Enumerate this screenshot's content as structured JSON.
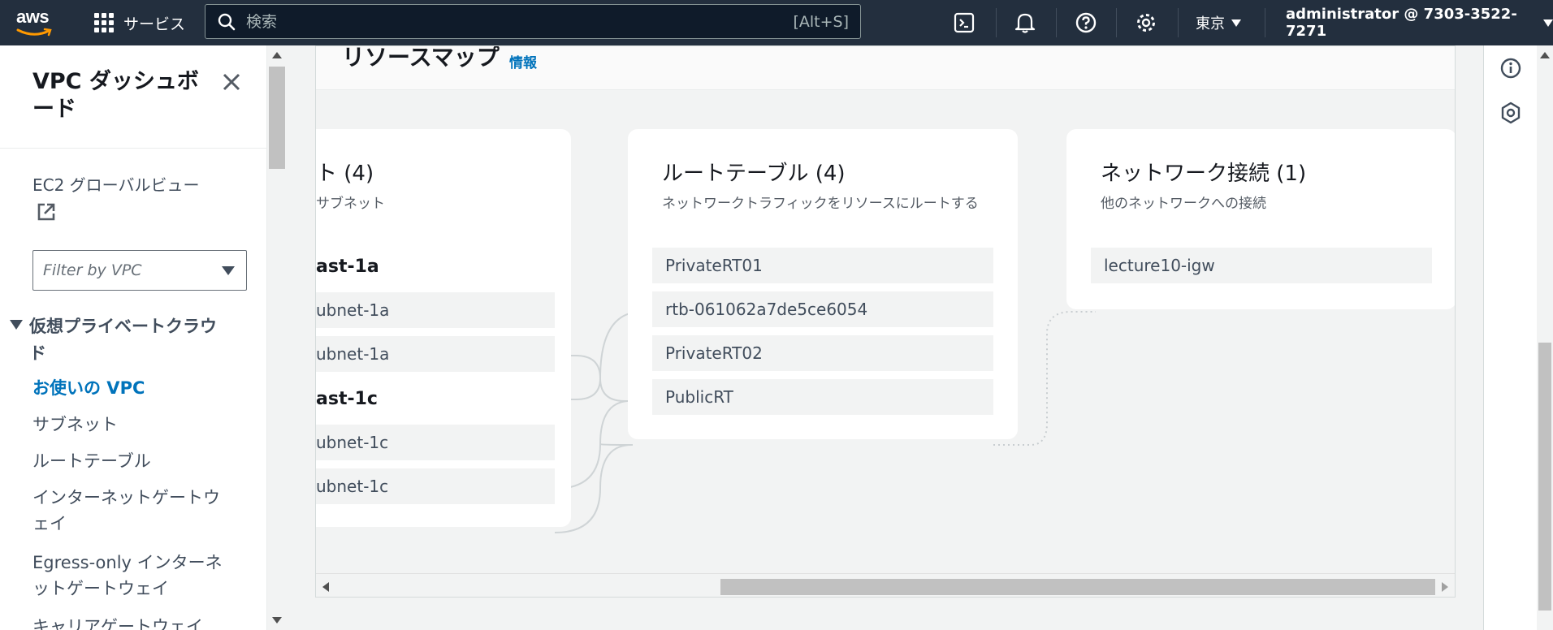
{
  "topnav": {
    "logo_text": "aws",
    "services_label": "サービス",
    "search_placeholder": "検索",
    "search_shortcut": "[Alt+S]",
    "icons": [
      "cloudshell-icon",
      "bell-icon",
      "help-icon",
      "gear-icon"
    ],
    "region": "東京",
    "account": "administrator @ 7303-3522-7271"
  },
  "sidebar": {
    "title": "VPC ダッシュボード",
    "ec2_global_view": "EC2 グローバルビュー",
    "filter_placeholder": "Filter by VPC",
    "section_title": "仮想プライベートクラウド",
    "links": [
      {
        "label": "お使いの VPC",
        "active": true
      },
      {
        "label": "サブネット"
      },
      {
        "label": "ルートテーブル"
      },
      {
        "label": "インターネットゲートウェイ"
      },
      {
        "label": "Egress-only インターネットゲートウェイ"
      },
      {
        "label": "キャリアゲートウェイ"
      }
    ]
  },
  "resource_map": {
    "title": "リソースマップ",
    "info_link": "情報",
    "subnets_card": {
      "title_fragment": "ト (4)",
      "desc_fragment": "サブネット",
      "az_groups": [
        {
          "az": "ast-1a",
          "subnets": [
            "ubnet-1a",
            "ubnet-1a"
          ]
        },
        {
          "az": "ast-1c",
          "subnets": [
            "ubnet-1c",
            "ubnet-1c"
          ]
        }
      ]
    },
    "route_tables_card": {
      "title": "ルートテーブル (4)",
      "desc": "ネットワークトラフィックをリソースにルートする",
      "items": [
        "PrivateRT01",
        "rtb-061062a7de5ce6054",
        "PrivateRT02",
        "PublicRT"
      ]
    },
    "network_card": {
      "title": "ネットワーク接続 (1)",
      "desc": "他のネットワークへの接続",
      "items": [
        "lecture10-igw"
      ]
    }
  },
  "right_rail": {
    "icons": [
      "info-icon",
      "feedback-icon"
    ]
  },
  "colors": {
    "nav_bg": "#232f3e",
    "link": "#0073bb",
    "canvas_bg": "#f2f3f3"
  }
}
